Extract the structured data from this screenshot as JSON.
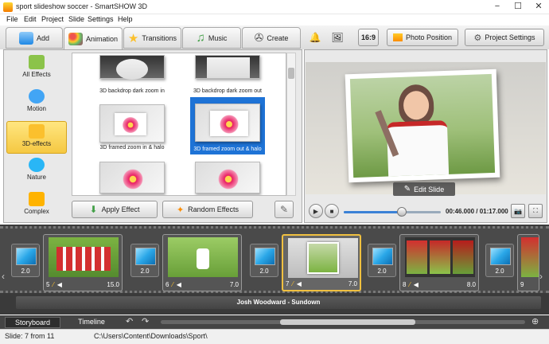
{
  "window": {
    "title": "sport slideshow soccer - SmartSHOW 3D",
    "controls": [
      "−",
      "☐",
      "✕"
    ]
  },
  "menu": [
    "File",
    "Edit",
    "Project",
    "Slide",
    "Settings",
    "Help"
  ],
  "tabs": [
    {
      "label": "Add",
      "icon": "add-photo-icon"
    },
    {
      "label": "Animation",
      "icon": "palette-icon"
    },
    {
      "label": "Transitions",
      "icon": "star-icon"
    },
    {
      "label": "Music",
      "icon": "music-note-icon"
    },
    {
      "label": "Create",
      "icon": "film-reel-icon"
    }
  ],
  "top_right": {
    "ratio": "16:9",
    "photo_position": "Photo Position",
    "project_settings": "Project Settings"
  },
  "categories": [
    {
      "label": "All Effects",
      "color": "#8bc34a"
    },
    {
      "label": "Motion",
      "color": "#42a5f5"
    },
    {
      "label": "3D-effects",
      "color": "#fbc02d"
    },
    {
      "label": "Nature",
      "color": "#29b6f6"
    },
    {
      "label": "Complex",
      "color": "#ffb300"
    }
  ],
  "effects": [
    {
      "label": "3D backdrop dark zoom in"
    },
    {
      "label": "3D backdrop dark zoom out"
    },
    {
      "label": "3D framed zoom in & halo"
    },
    {
      "label": "3D framed zoom out & halo"
    }
  ],
  "gallery_buttons": {
    "apply": "Apply Effect",
    "random": "Random Effects"
  },
  "preview": {
    "edit_slide": "Edit Slide",
    "time": "00:46.000 / 01:17.000",
    "progress": 0.6
  },
  "slides": [
    {
      "num": "5",
      "dur": "15.0"
    },
    {
      "num": "6",
      "dur": "7.0"
    },
    {
      "num": "7",
      "dur": "7.0"
    },
    {
      "num": "8",
      "dur": "8.0"
    },
    {
      "num": "9",
      "dur": ""
    }
  ],
  "transitions": [
    "2.0",
    "2.0",
    "2.0",
    "2.0",
    "2.0",
    "2.0"
  ],
  "audio_track": "Josh Woodward - Sundown",
  "bottom_tabs": [
    "Storyboard",
    "Timeline"
  ],
  "status": {
    "slide": "Slide: 7 from 11",
    "path": "C:\\Users\\Content\\Downloads\\Sport\\"
  }
}
